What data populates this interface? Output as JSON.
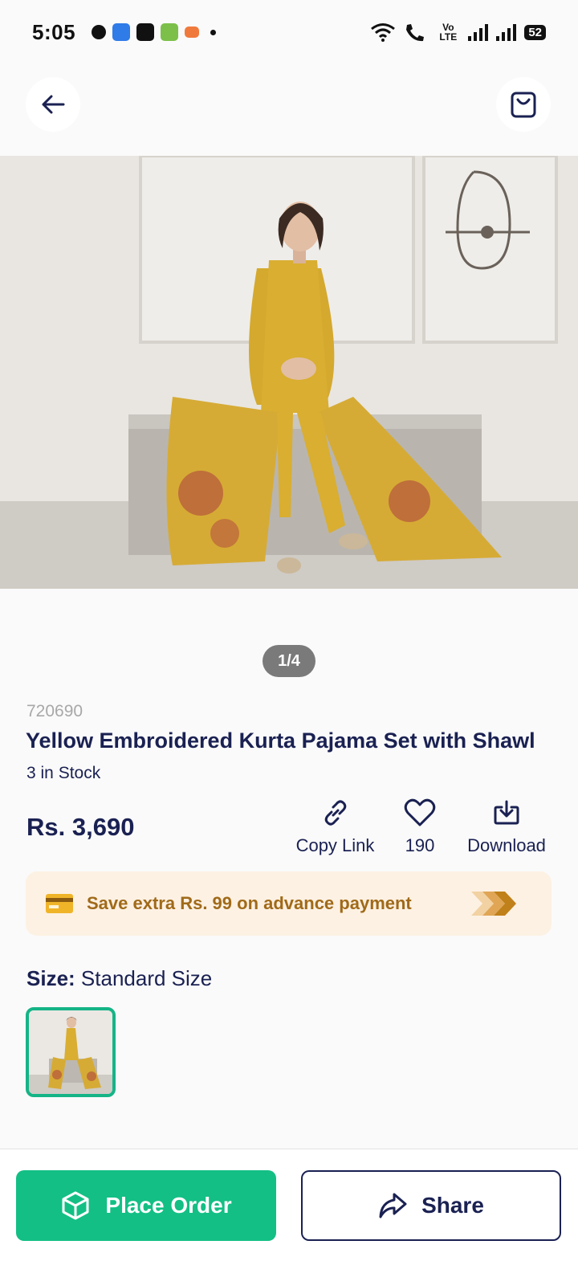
{
  "status_bar": {
    "time": "5:05",
    "network": "Vo LTE",
    "battery": "52"
  },
  "product": {
    "image_counter": "1/4",
    "sku": "720690",
    "title": "Yellow Embroidered Kurta Pajama Set with Shawl",
    "stock": "3 in Stock",
    "price": "Rs. 3,690"
  },
  "actions": {
    "copy_link": "Copy Link",
    "likes": "190",
    "download": "Download"
  },
  "promo": {
    "text": "Save extra Rs. 99 on advance payment"
  },
  "size": {
    "label": "Size:",
    "value": "Standard Size"
  },
  "bottom": {
    "place_order": "Place Order",
    "share": "Share"
  },
  "colors": {
    "primary": "#13bf84",
    "navy": "#1a2152",
    "promo_bg": "#fdf1e3",
    "promo_text": "#a06a19"
  }
}
